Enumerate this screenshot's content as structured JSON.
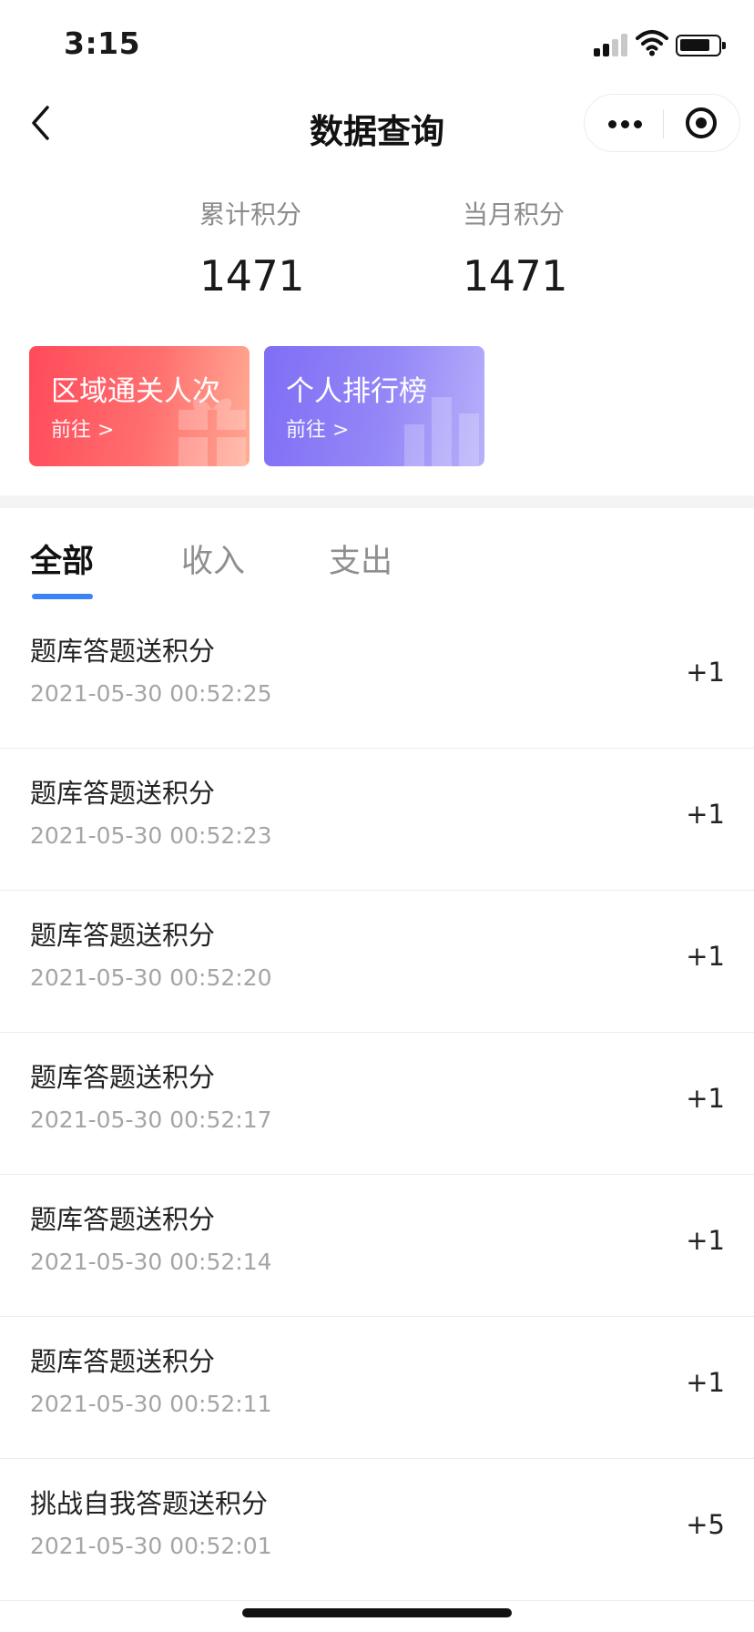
{
  "status_bar": {
    "time": "3:15"
  },
  "nav": {
    "title": "数据查询"
  },
  "stats": [
    {
      "label": "累计积分",
      "value": "1471"
    },
    {
      "label": "当月积分",
      "value": "1471"
    }
  ],
  "cards": [
    {
      "title": "区域通关人次",
      "link": "前往 >",
      "color": "#ff4a5a"
    },
    {
      "title": "个人排行榜",
      "link": "前往 >",
      "color": "#7f6ef5"
    }
  ],
  "tabs": [
    {
      "label": "全部",
      "active": true
    },
    {
      "label": "收入",
      "active": false
    },
    {
      "label": "支出",
      "active": false
    }
  ],
  "accent_color": "#3b82f6",
  "records": [
    {
      "title": "题库答题送积分",
      "time": "2021-05-30 00:52:25",
      "amount": "+1"
    },
    {
      "title": "题库答题送积分",
      "time": "2021-05-30 00:52:23",
      "amount": "+1"
    },
    {
      "title": "题库答题送积分",
      "time": "2021-05-30 00:52:20",
      "amount": "+1"
    },
    {
      "title": "题库答题送积分",
      "time": "2021-05-30 00:52:17",
      "amount": "+1"
    },
    {
      "title": "题库答题送积分",
      "time": "2021-05-30 00:52:14",
      "amount": "+1"
    },
    {
      "title": "题库答题送积分",
      "time": "2021-05-30 00:52:11",
      "amount": "+1"
    },
    {
      "title": "挑战自我答题送积分",
      "time": "2021-05-30 00:52:01",
      "amount": "+5"
    }
  ]
}
